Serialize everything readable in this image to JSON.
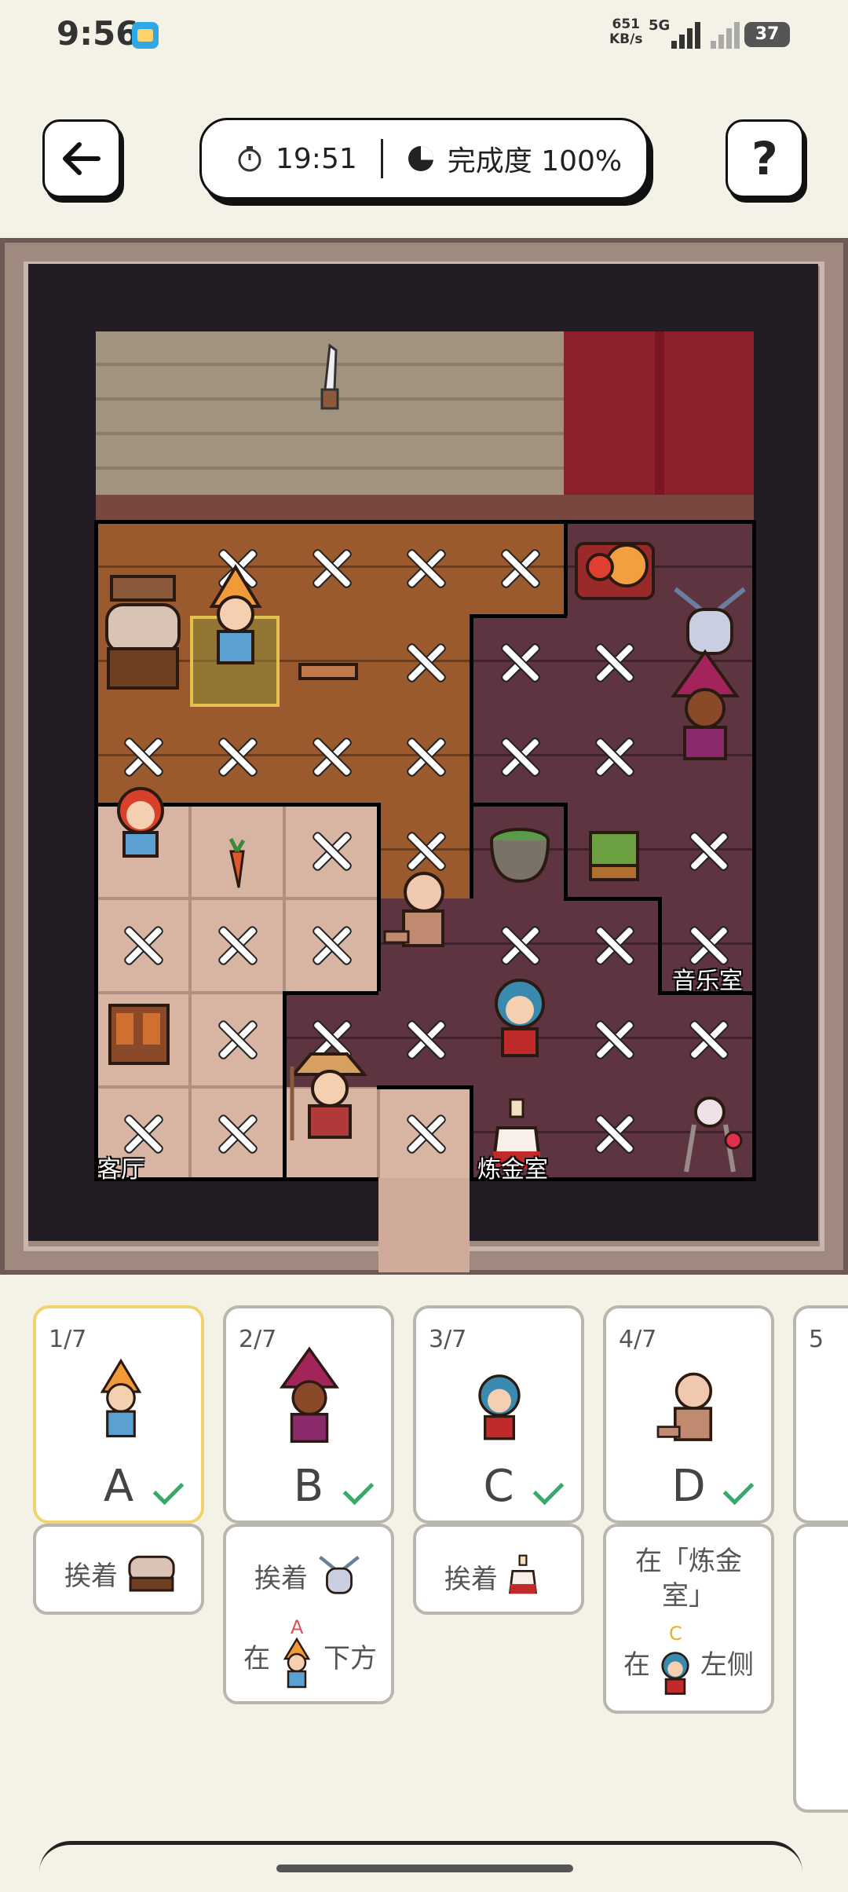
{
  "status_bar": {
    "time": "9:56",
    "network_speed": "651",
    "network_unit": "KB/s",
    "network_type": "5G",
    "battery": "37"
  },
  "header": {
    "timer": "19:51",
    "completion": "完成度 100%",
    "help": "?"
  },
  "rooms": {
    "living_room": "客厅",
    "alchemy_room": "炼金室",
    "music_room": "音乐室"
  },
  "cards": [
    {
      "index": "1/7",
      "letter": "A",
      "done": true
    },
    {
      "index": "2/7",
      "letter": "B",
      "done": true
    },
    {
      "index": "3/7",
      "letter": "C",
      "done": true
    },
    {
      "index": "4/7",
      "letter": "D",
      "done": true
    },
    {
      "index": "5"
    }
  ],
  "clues": {
    "a_next_to": "挨着",
    "b_next_to": "挨着",
    "b_at": "在",
    "b_below": "下方",
    "b_ref_letter": "A",
    "c_next_to": "挨着",
    "d_in_room": "在「炼金",
    "d_in_room2": "室」",
    "d_at": "在",
    "d_left": "左侧",
    "d_ref_letter": "C"
  },
  "colors": {
    "selected_border": "#f0d36a",
    "check": "#3aa76b",
    "curtain": "#8e1f2c"
  }
}
